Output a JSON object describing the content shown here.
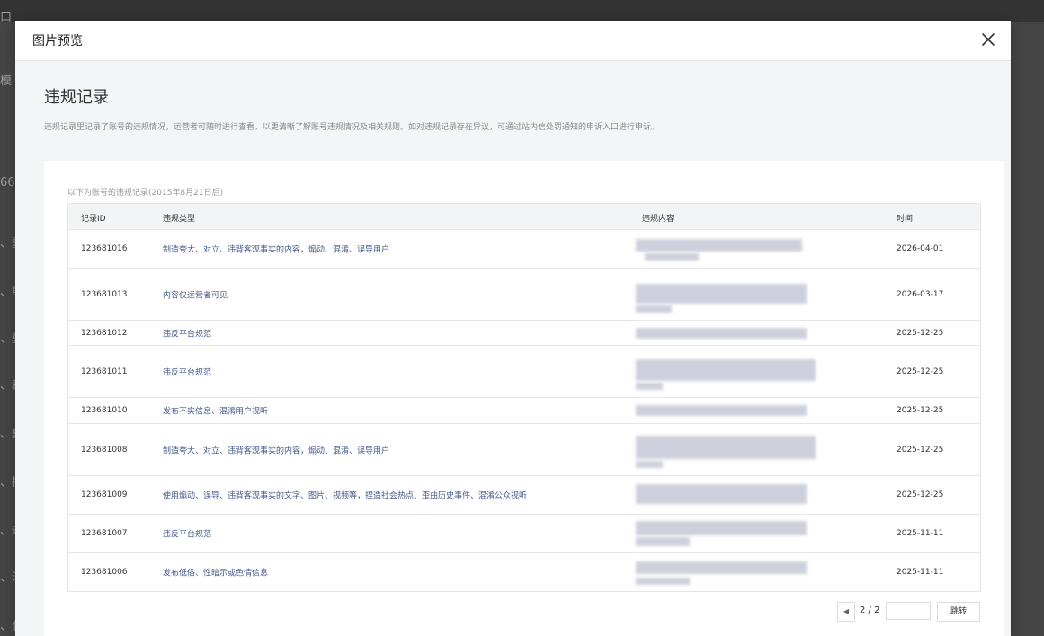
{
  "background": {
    "fragments": [
      "口",
      "模",
      "66:",
      "、冀",
      "、展",
      "、冀",
      "、裁",
      "、冀",
      "、挖",
      "、述",
      "、涉",
      "、化"
    ]
  },
  "modal": {
    "title": "图片预览"
  },
  "content": {
    "heading": "违规记录",
    "description": "违规记录里记录了账号的违规情况，运营者可随时进行查看，以更清晰了解账号违规情况及相关规则。如对违规记录存在异议，可通过站内信处罚通知的申诉入口进行申诉。",
    "caption": "以下为账号的违规记录(2015年8月21日后)",
    "columns": {
      "id": "记录ID",
      "type": "违规类型",
      "content": "违规内容",
      "time": "时间"
    },
    "rows": [
      {
        "id": "123681016",
        "type": "制造夸大、对立、违背客观事实的内容，煽动、混淆、误导用户",
        "time": "2026-04-01"
      },
      {
        "id": "123681013",
        "type": "内容仅运营者可见",
        "time": "2026-03-17"
      },
      {
        "id": "123681012",
        "type": "违反平台规范",
        "time": "2025-12-25"
      },
      {
        "id": "123681011",
        "type": "违反平台规范",
        "time": "2025-12-25"
      },
      {
        "id": "123681010",
        "type": "发布不实信息、混淆用户视听",
        "time": "2025-12-25"
      },
      {
        "id": "123681008",
        "type": "制造夸大、对立、违背客观事实的内容，煽动、混淆、误导用户",
        "time": "2025-12-25"
      },
      {
        "id": "123681009",
        "type": "使用煽动、误导、违背客观事实的文字、图片、视频等，捏造社会热点、歪曲历史事件、混淆公众视听",
        "time": "2025-12-25"
      },
      {
        "id": "123681007",
        "type": "违反平台规范",
        "time": "2025-11-11"
      },
      {
        "id": "123681006",
        "type": "发布低俗、性暗示或色情信息",
        "time": "2025-11-11"
      }
    ]
  },
  "pagination": {
    "prev_icon": "caret-left-icon",
    "page_text": "2 / 2",
    "input_value": "",
    "jump_label": "跳转"
  }
}
